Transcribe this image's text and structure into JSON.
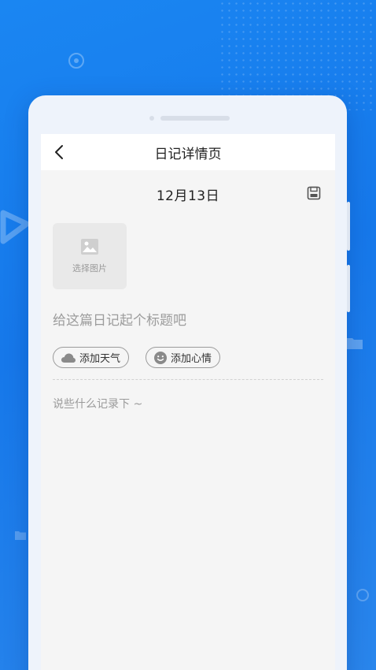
{
  "header": {
    "title": "日记详情页",
    "back_icon": "chevron-left-icon"
  },
  "date": "12月13日",
  "save_icon": "save-icon",
  "image_picker": {
    "label": "选择图片",
    "icon": "image-icon"
  },
  "title_field": {
    "placeholder": "给这篇日记起个标题吧",
    "value": ""
  },
  "chips": {
    "weather_label": "添加天气",
    "weather_icon": "cloud-icon",
    "mood_label": "添加心情",
    "mood_icon": "smiley-icon"
  },
  "content_field": {
    "placeholder": "说些什么记录下 ~",
    "value": ""
  },
  "colors": {
    "background": "#1678ea",
    "screen": "#f5f5f5",
    "header": "#ffffff"
  }
}
